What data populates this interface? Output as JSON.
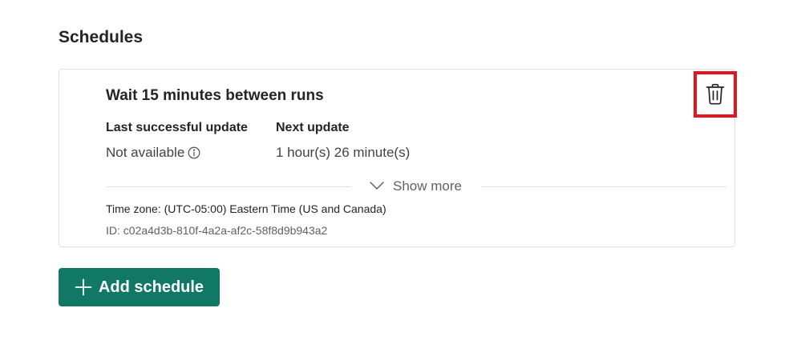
{
  "section": {
    "title": "Schedules"
  },
  "schedule": {
    "title": "Wait 15 minutes between runs",
    "last_update_label": "Last successful update",
    "last_update_value": "Not available",
    "next_update_label": "Next update",
    "next_update_value": "1 hour(s) 26 minute(s)",
    "show_more_label": "Show more",
    "timezone": "Time zone: (UTC-05:00) Eastern Time (US and Canada)",
    "id": "ID: c02a4d3b-810f-4a2a-af2c-58f8d9b943a2",
    "icons": {
      "delete": "trash-icon",
      "info": "info-icon",
      "expand": "chevron-down-icon"
    }
  },
  "actions": {
    "add_schedule_label": "Add schedule",
    "add_icon": "plus-icon"
  },
  "colors": {
    "primary_button": "#117865",
    "highlight_border": "#e3151f",
    "card_border": "#e0e0e0",
    "text_primary": "#242424",
    "text_secondary": "#616161"
  }
}
